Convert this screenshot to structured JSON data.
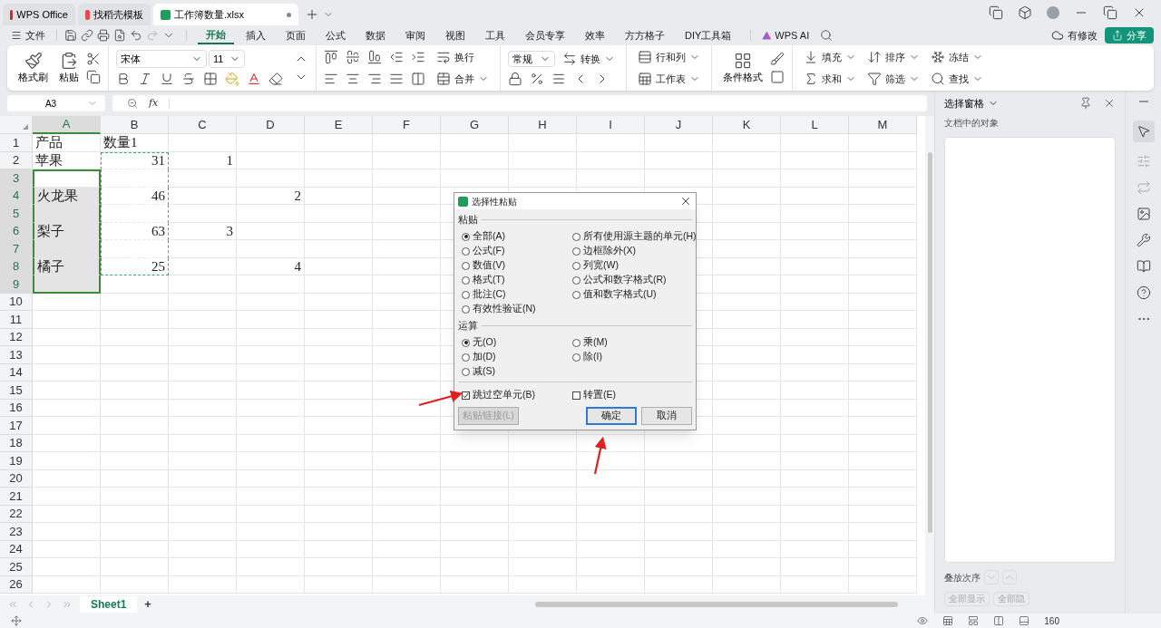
{
  "browser_tabs": [
    {
      "label": "WPS Office",
      "selected": false
    },
    {
      "label": "找稻壳模板",
      "selected": false
    },
    {
      "label": "工作簿数量.xlsx",
      "selected": true
    }
  ],
  "menu": {
    "file": "文件",
    "tabs": [
      {
        "label": "开始",
        "selected": true
      },
      {
        "label": "插入",
        "selected": false
      },
      {
        "label": "页面",
        "selected": false
      },
      {
        "label": "公式",
        "selected": false
      },
      {
        "label": "数据",
        "selected": false
      },
      {
        "label": "审阅",
        "selected": false
      },
      {
        "label": "视图",
        "selected": false
      },
      {
        "label": "工具",
        "selected": false
      },
      {
        "label": "会员专享",
        "selected": false
      },
      {
        "label": "效率",
        "selected": false
      },
      {
        "label": "方方格子",
        "selected": false
      },
      {
        "label": "DIY工具箱",
        "selected": false
      }
    ],
    "ai": "WPS AI",
    "modified": "有修改",
    "share": "分享"
  },
  "ribbon": {
    "clipboard": [
      "格式刷",
      "粘贴"
    ],
    "font": {
      "family": "宋体",
      "size": "11"
    },
    "alignment": [
      "换行",
      "合并"
    ],
    "number": {
      "format": "常规",
      "convert": "转换"
    },
    "cells": [
      "行和列",
      "工作表"
    ],
    "styles": [
      "条件格式"
    ],
    "editing": [
      "填充",
      "排序",
      "冻结",
      "求和",
      "筛选",
      "查找"
    ]
  },
  "formula_bar": {
    "name_box": "A3",
    "fx": "fx"
  },
  "sheet": {
    "columns": [
      {
        "label": "A",
        "selected": true,
        "copied": false
      },
      {
        "label": "B",
        "selected": false,
        "copied": true
      },
      {
        "label": "C",
        "selected": false,
        "copied": false
      },
      {
        "label": "D",
        "selected": false,
        "copied": false
      },
      {
        "label": "E",
        "selected": false,
        "copied": false
      },
      {
        "label": "F",
        "selected": false,
        "copied": false
      },
      {
        "label": "G",
        "selected": false,
        "copied": false
      },
      {
        "label": "H",
        "selected": false,
        "copied": false
      },
      {
        "label": "I",
        "selected": false,
        "copied": false
      },
      {
        "label": "J",
        "selected": false,
        "copied": false
      },
      {
        "label": "K",
        "selected": false,
        "copied": false
      },
      {
        "label": "L",
        "selected": false,
        "copied": false
      },
      {
        "label": "M",
        "selected": false,
        "copied": false
      }
    ],
    "rows": [
      {
        "number": "1",
        "selected": false,
        "copied": false,
        "cells": [
          {
            "text": "产品",
            "kind": "text"
          },
          {
            "text": "数量1",
            "kind": "text"
          }
        ]
      },
      {
        "number": "2",
        "selected": false,
        "copied": true,
        "cells": [
          {
            "text": "苹果",
            "kind": "text"
          },
          {
            "text": "31",
            "kind": "number"
          },
          {
            "text": "1",
            "kind": "number"
          }
        ]
      },
      {
        "number": "3",
        "selected": true,
        "copied": true
      },
      {
        "number": "4",
        "selected": true,
        "copied": true,
        "cells": [
          {
            "text": "火龙果",
            "kind": "text"
          },
          {
            "text": "46",
            "kind": "number"
          },
          {},
          {
            "text": "2",
            "kind": "number"
          }
        ]
      },
      {
        "number": "5",
        "selected": true,
        "copied": true
      },
      {
        "number": "6",
        "selected": true,
        "copied": true,
        "cells": [
          {
            "text": "梨子",
            "kind": "text"
          },
          {
            "text": "63",
            "kind": "number"
          },
          {
            "text": "3",
            "kind": "number"
          }
        ]
      },
      {
        "number": "7",
        "selected": true,
        "copied": true
      },
      {
        "number": "8",
        "selected": true,
        "copied": true,
        "cells": [
          {
            "text": "橘子",
            "kind": "text"
          },
          {
            "text": "25",
            "kind": "number"
          },
          {},
          {
            "text": "4",
            "kind": "number"
          }
        ]
      },
      {
        "number": "9",
        "selected": true,
        "copied": false
      },
      {
        "number": "10",
        "selected": false,
        "copied": false
      },
      {
        "number": "11",
        "selected": false,
        "copied": false
      },
      {
        "number": "12",
        "selected": false,
        "copied": false
      },
      {
        "number": "13",
        "selected": false,
        "copied": false
      },
      {
        "number": "14",
        "selected": false,
        "copied": false
      },
      {
        "number": "15",
        "selected": false,
        "copied": false
      },
      {
        "number": "16",
        "selected": false,
        "copied": false
      },
      {
        "number": "17",
        "selected": false,
        "copied": false
      },
      {
        "number": "18",
        "selected": false,
        "copied": false
      },
      {
        "number": "19",
        "selected": false,
        "copied": false
      },
      {
        "number": "20",
        "selected": false,
        "copied": false
      },
      {
        "number": "21",
        "selected": false,
        "copied": false
      },
      {
        "number": "22",
        "selected": false,
        "copied": false
      },
      {
        "number": "23",
        "selected": false,
        "copied": false
      },
      {
        "number": "24",
        "selected": false,
        "copied": false
      },
      {
        "number": "25",
        "selected": false,
        "copied": false
      },
      {
        "number": "26",
        "selected": false,
        "copied": false
      }
    ],
    "tabs": [
      {
        "label": "Sheet1",
        "selected": true
      }
    ],
    "add": "+"
  },
  "dialog": {
    "title": "选择性粘贴",
    "sections": [
      {
        "title": "粘贴",
        "options": [
          {
            "label": "全部(A)",
            "selected": true
          },
          {
            "label": "所有使用源主题的单元(H)",
            "selected": false
          },
          {
            "label": "公式(F)",
            "selected": false
          },
          {
            "label": "边框除外(X)",
            "selected": false
          },
          {
            "label": "数值(V)",
            "selected": false
          },
          {
            "label": "列宽(W)",
            "selected": false
          },
          {
            "label": "格式(T)",
            "selected": false
          },
          {
            "label": "公式和数字格式(R)",
            "selected": false
          },
          {
            "label": "批注(C)",
            "selected": false
          },
          {
            "label": "值和数字格式(U)",
            "selected": false
          },
          {
            "label": "有效性验证(N)",
            "selected": false
          }
        ]
      },
      {
        "title": "运算",
        "options": [
          {
            "label": "无(O)",
            "selected": true
          },
          {
            "label": "乘(M)",
            "selected": false
          },
          {
            "label": "加(D)",
            "selected": false
          },
          {
            "label": "除(I)",
            "selected": false
          },
          {
            "label": "减(S)",
            "selected": false
          }
        ]
      }
    ],
    "checkboxes": [
      {
        "label": "跳过空单元(B)",
        "checked": true
      },
      {
        "label": "转置(E)",
        "checked": false
      }
    ],
    "buttons": [
      {
        "label": "粘贴链接(L)",
        "disabled": true,
        "default": false
      },
      {
        "label": "确定",
        "disabled": false,
        "default": true
      },
      {
        "label": "取消",
        "disabled": false,
        "default": false
      }
    ]
  },
  "selection_pane": {
    "title": "选择窗格",
    "subtitle": "文档中的对象",
    "order_label": "叠放次序",
    "buttons": [
      "全部显示",
      "全部隐"
    ]
  },
  "status_bar": {
    "zoom": "160"
  }
}
